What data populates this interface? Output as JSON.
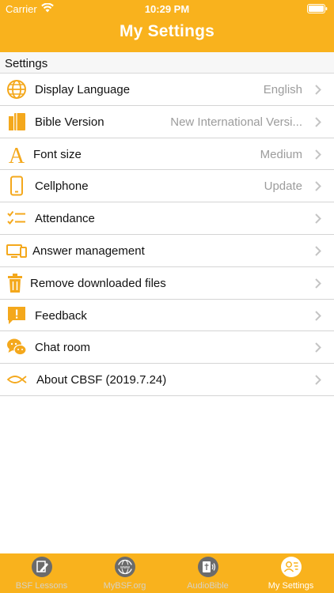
{
  "status_bar": {
    "carrier": "Carrier",
    "time": "10:29 PM"
  },
  "header": {
    "title": "My Settings"
  },
  "section": {
    "title": "Settings"
  },
  "colors": {
    "accent": "#f9b21d",
    "tab_inactive": "#6b6b6b"
  },
  "rows": [
    {
      "label": "Display Language",
      "value": "English",
      "icon": "globe-icon"
    },
    {
      "label": "Bible Version",
      "value": "New International Versi...",
      "icon": "books-icon"
    },
    {
      "label": "Font size",
      "value": "Medium",
      "icon": "font-size-icon"
    },
    {
      "label": "Cellphone",
      "value": "Update",
      "icon": "phone-icon"
    },
    {
      "label": "Attendance",
      "value": "",
      "icon": "checklist-icon"
    },
    {
      "label": "Answer management",
      "value": "",
      "icon": "devices-icon"
    },
    {
      "label": "Remove downloaded files",
      "value": "",
      "icon": "trash-icon"
    },
    {
      "label": "Feedback",
      "value": "",
      "icon": "feedback-icon"
    },
    {
      "label": "Chat room",
      "value": "",
      "icon": "chat-icon"
    },
    {
      "label": "About CBSF (2019.7.24)",
      "value": "",
      "icon": "fish-icon"
    }
  ],
  "tabs": [
    {
      "label": "BSF Lessons",
      "icon": "lesson-edit-icon",
      "active": false
    },
    {
      "label": "MyBSF.org",
      "icon": "www-globe-icon",
      "active": false
    },
    {
      "label": "AudioBible",
      "icon": "audio-bible-icon",
      "active": false
    },
    {
      "label": "My Settings",
      "icon": "profile-icon",
      "active": true
    }
  ]
}
